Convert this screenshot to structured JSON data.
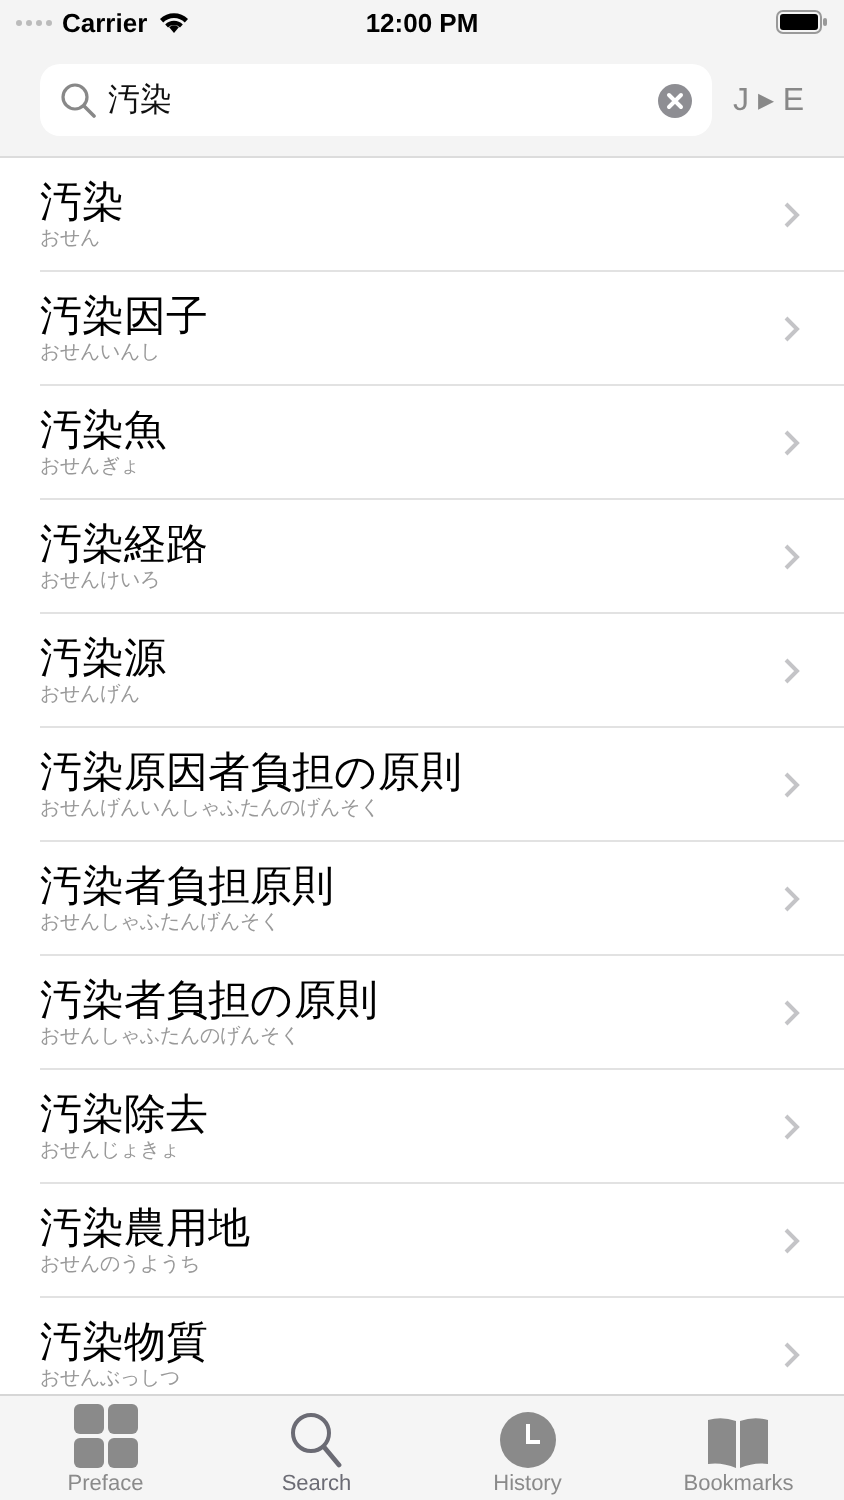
{
  "status_bar": {
    "carrier": "Carrier",
    "time": "12:00 PM"
  },
  "search": {
    "value": "汚染",
    "direction": "J ▸ E"
  },
  "entries": [
    {
      "word": "汚染",
      "reading": "おせん"
    },
    {
      "word": "汚染因子",
      "reading": "おせんいんし"
    },
    {
      "word": "汚染魚",
      "reading": "おせんぎょ"
    },
    {
      "word": "汚染経路",
      "reading": "おせんけいろ"
    },
    {
      "word": "汚染源",
      "reading": "おせんげん"
    },
    {
      "word": "汚染原因者負担の原則",
      "reading": "おせんげんいんしゃふたんのげんそく"
    },
    {
      "word": "汚染者負担原則",
      "reading": "おせんしゃふたんげんそく"
    },
    {
      "word": "汚染者負担の原則",
      "reading": "おせんしゃふたんのげんそく"
    },
    {
      "word": "汚染除去",
      "reading": "おせんじょきょ"
    },
    {
      "word": "汚染農用地",
      "reading": "おせんのうようち"
    },
    {
      "word": "汚染物質",
      "reading": "おせんぶっしつ"
    }
  ],
  "tabs": [
    {
      "label": "Preface",
      "kind": "grid",
      "selected": false
    },
    {
      "label": "Search",
      "kind": "search",
      "selected": true
    },
    {
      "label": "History",
      "kind": "clock",
      "selected": false
    },
    {
      "label": "Bookmarks",
      "kind": "book",
      "selected": false
    }
  ]
}
